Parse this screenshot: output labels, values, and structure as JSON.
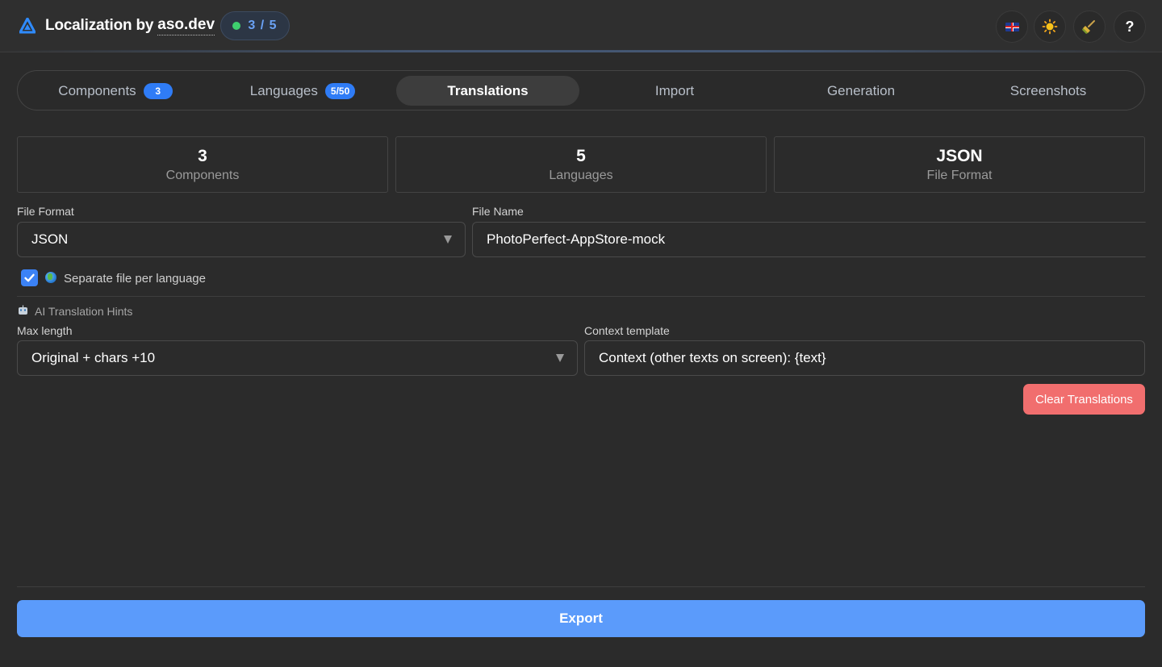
{
  "header": {
    "title": "Localization by",
    "brand_link": "aso.dev",
    "progress": "3 / 5",
    "progress_dot_color": "#3ecf6e",
    "buttons": [
      {
        "name": "language-flag-icon"
      },
      {
        "name": "sun-icon"
      },
      {
        "name": "broom-icon"
      },
      {
        "name": "help-icon",
        "label": "?"
      }
    ]
  },
  "tabs": [
    {
      "label": "Components",
      "badge": "3"
    },
    {
      "label": "Languages",
      "badge": "5/50"
    },
    {
      "label": "Translations",
      "active": true
    },
    {
      "label": "Import"
    },
    {
      "label": "Generation"
    },
    {
      "label": "Screenshots"
    }
  ],
  "stats": [
    {
      "value": "3",
      "label": "Components"
    },
    {
      "value": "5",
      "label": "Languages"
    },
    {
      "value": "JSON",
      "label": "File Format"
    }
  ],
  "form": {
    "file_format_label": "File Format",
    "file_format_value": "JSON",
    "file_name_label": "File Name",
    "file_name_value": "PhotoPerfect-AppStore-mock",
    "separate_file_label": "Separate file per language",
    "separate_file_checked": true,
    "ai_hints_label": "AI Translation Hints",
    "max_length_label": "Max length",
    "max_length_value": "Original + chars +10",
    "context_template_label": "Context template",
    "context_template_value": "Context (other texts on screen): {text}"
  },
  "actions": {
    "clear_label": "Clear Translations",
    "export_label": "Export"
  },
  "colors": {
    "accent": "#5b9bfb",
    "badge": "#2f7cf6",
    "danger": "#f16e6e",
    "background": "#2b2b2b"
  }
}
